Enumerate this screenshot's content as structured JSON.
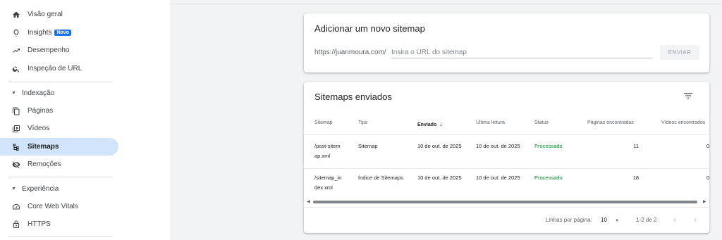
{
  "sidebar": {
    "items_top": [
      {
        "label": "Visão geral",
        "icon": "home-icon"
      },
      {
        "label": "Insights",
        "icon": "lightbulb-icon",
        "badge": "Novo"
      },
      {
        "label": "Desempenho",
        "icon": "trending-up-icon"
      },
      {
        "label": "Inspeção de URL",
        "icon": "search-icon"
      }
    ],
    "section_indexacao": "Indexação",
    "items_indexacao": [
      {
        "label": "Páginas",
        "icon": "pages-icon"
      },
      {
        "label": "Vídeos",
        "icon": "video-icon"
      },
      {
        "label": "Sitemaps",
        "icon": "sitemap-icon",
        "active": true
      },
      {
        "label": "Remoções",
        "icon": "visibility-off-icon"
      }
    ],
    "section_experiencia": "Experiência",
    "items_experiencia": [
      {
        "label": "Core Web Vitals",
        "icon": "speed-gauge-icon"
      },
      {
        "label": "HTTPS",
        "icon": "lock-icon"
      }
    ]
  },
  "add_sitemap": {
    "title": "Adicionar um novo sitemap",
    "prefix": "https://juanmoura.com/",
    "placeholder": "Insira o URL do sitemap",
    "value": "",
    "submit_label": "ENVIAR"
  },
  "submitted": {
    "title": "Sitemaps enviados",
    "columns": [
      "Sitemap",
      "Tipo",
      "Enviado",
      "Última leitura",
      "Status",
      "Páginas encontradas",
      "Vídeos encontrados"
    ],
    "sorted_column": "Enviado",
    "rows": [
      {
        "sitemap_1": "/post-sitem",
        "sitemap_2": "ap.xml",
        "type": "Sitemap",
        "submitted": "10 de out. de 2025",
        "last_read": "10 de out. de 2025",
        "status": "Processado",
        "pages": "11",
        "videos": "0"
      },
      {
        "sitemap_1": "/sitemap_in",
        "sitemap_2": "dex.xml",
        "type": "Índice de Sitemaps",
        "submitted": "10 de out. de 2025",
        "last_read": "10 de out. de 2025",
        "status": "Processado",
        "pages": "18",
        "videos": "0"
      }
    ],
    "footer": {
      "rows_per_page_label": "Linhas por página:",
      "rows_per_page": "10",
      "range": "1-2 de 2"
    }
  },
  "colors": {
    "accent": "#1a73e8",
    "active_bg": "#d2e3fc",
    "status_ok": "#188038"
  }
}
